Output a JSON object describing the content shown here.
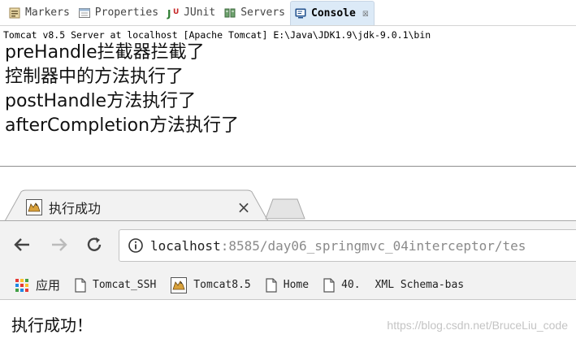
{
  "eclipse": {
    "tabs": [
      {
        "label": "Markers",
        "icon": "markers-icon"
      },
      {
        "label": "Properties",
        "icon": "properties-icon"
      },
      {
        "label": "JUnit",
        "icon": "junit-icon"
      },
      {
        "label": "Servers",
        "icon": "servers-icon"
      },
      {
        "label": "Console",
        "icon": "console-icon",
        "close": "☒"
      }
    ],
    "console_header": "Tomcat v8.5 Server at localhost [Apache Tomcat] E:\\Java\\JDK1.9\\jdk-9.0.1\\bin",
    "console_lines": [
      "preHandle拦截器拦截了",
      "控制器中的方法执行了",
      "postHandle方法执行了",
      "afterCompletion方法执行了"
    ]
  },
  "browser": {
    "tab": {
      "title": "执行成功",
      "close": "×"
    },
    "url_host": "localhost",
    "url_rest": ":8585/day06_springmvc_04interceptor/tes",
    "bookmarks": [
      {
        "label": "应用",
        "icon": "apps-grid-icon"
      },
      {
        "label": "Tomcat_SSH",
        "icon": "page-icon"
      },
      {
        "label": "Tomcat8.5",
        "icon": "tomcat-icon"
      },
      {
        "label": "Home",
        "icon": "page-icon"
      },
      {
        "label": "40.",
        "icon": "page-icon"
      },
      {
        "label": "XML Schema-bas",
        "icon": ""
      }
    ],
    "page_text": "执行成功！",
    "watermark": "https://blog.csdn.net/BruceLiu_code"
  },
  "colors": {
    "active_tab": "#dceaf7",
    "toolbar": "#f2f2f2"
  }
}
